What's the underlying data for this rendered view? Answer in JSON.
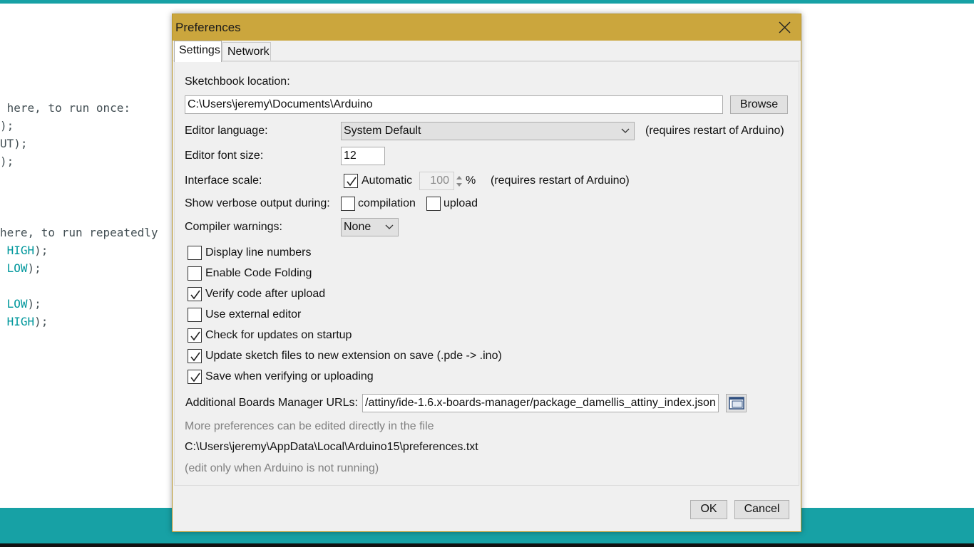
{
  "background_editor": {
    "code_lines": [
      {
        "text": " here, to run once:",
        "kw": ""
      },
      {
        "text": ");",
        "kw": ""
      },
      {
        "text": "UT);",
        "kw": ""
      },
      {
        "text": ");",
        "kw": ""
      },
      {
        "text": "here, to run repeatedly",
        "kw": ""
      },
      {
        "text": " HIGH);",
        "kw": "HIGH"
      },
      {
        "text": " LOW);",
        "kw": "LOW"
      },
      {
        "text": " LOW);",
        "kw": "LOW"
      },
      {
        "text": " HIGH);",
        "kw": "HIGH"
      }
    ],
    "accent_color": "#17a1a5",
    "keyword_color": "#00979c"
  },
  "dialog": {
    "title": "Preferences",
    "titlebar_color": "#cba63d",
    "tabs": [
      "Settings",
      "Network"
    ],
    "sketchbook": {
      "label": "Sketchbook location:",
      "path": "C:\\Users\\jeremy\\Documents\\Arduino",
      "browse_label": "Browse"
    },
    "editor_language": {
      "label": "Editor language:",
      "value": "System Default",
      "note": "(requires restart of Arduino)"
    },
    "font_size": {
      "label": "Editor font size:",
      "value": "12"
    },
    "interface_scale": {
      "label": "Interface scale:",
      "automatic_label": "Automatic",
      "automatic_checked": true,
      "value": "100",
      "unit": "%",
      "note": "(requires restart of Arduino)"
    },
    "verbose": {
      "label": "Show verbose output during:",
      "compilation_label": "compilation",
      "compilation_checked": false,
      "upload_label": "upload",
      "upload_checked": false
    },
    "compiler_warnings": {
      "label": "Compiler warnings:",
      "value": "None"
    },
    "options": [
      {
        "label": "Display line numbers",
        "checked": false
      },
      {
        "label": "Enable Code Folding",
        "checked": false
      },
      {
        "label": "Verify code after upload",
        "checked": true
      },
      {
        "label": "Use external editor",
        "checked": false
      },
      {
        "label": "Check for updates on startup",
        "checked": true
      },
      {
        "label": "Update sketch files to new extension on save (.pde -> .ino)",
        "checked": true
      },
      {
        "label": "Save when verifying or uploading",
        "checked": true
      }
    ],
    "boards_manager": {
      "label": "Additional Boards Manager URLs:",
      "value": "/attiny/ide-1.6.x-boards-manager/package_damellis_attiny_index.json",
      "button_icon": "window-icon"
    },
    "more_prefs_text": "More preferences can be edited directly in the file",
    "prefs_path": "C:\\Users\\jeremy\\AppData\\Local\\Arduino15\\preferences.txt",
    "edit_note": "(edit only when Arduino is not running)",
    "ok_label": "OK",
    "cancel_label": "Cancel",
    "close_icon": "close-icon"
  }
}
